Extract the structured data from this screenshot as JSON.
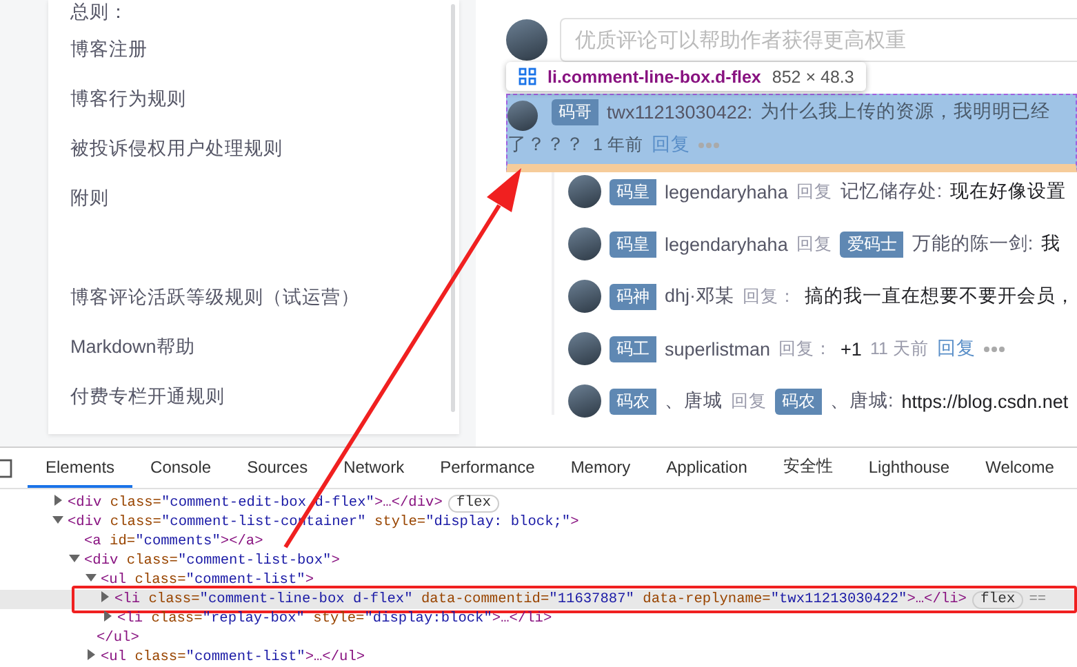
{
  "sidebar": {
    "groups": [
      {
        "items": [
          {
            "label": "总则：",
            "selected": false
          },
          {
            "label": "博客注册",
            "selected": false
          },
          {
            "label": "博客行为规则",
            "selected": false
          },
          {
            "label": "被投诉侵权用户处理规则",
            "selected": false
          },
          {
            "label": "附则",
            "selected": false
          }
        ]
      },
      {
        "items": [
          {
            "label": "博客评论活跃等级规则（试运营）",
            "selected": false
          },
          {
            "label": "Markdown帮助",
            "selected": false
          },
          {
            "label": "付费专栏开通规则",
            "selected": false
          }
        ]
      }
    ]
  },
  "comment_input": {
    "placeholder": "优质评论可以帮助作者获得更高权重"
  },
  "inspect_tooltip": {
    "selector": "li.comment-line-box.d-flex",
    "size": "852 × 48.3"
  },
  "comment": {
    "badge": "码哥",
    "name": "twx11213030422:",
    "text": "为什么我上传的资源，我明明已经",
    "text_cont": "了？？？",
    "time": "1 年前",
    "reply": "回复",
    "highlighted": true
  },
  "replies": [
    {
      "badge": "码皇",
      "name": "legendaryhaha",
      "action": "回复",
      "target": "记忆储存处:",
      "text": "现在好像设置"
    },
    {
      "badge": "码皇",
      "name": "legendaryhaha",
      "action": "回复",
      "target_badge": "爱码士",
      "target": "万能的陈一剑:",
      "text": "我"
    },
    {
      "badge": "码神",
      "name": "dhj·邓某",
      "action": "回复：",
      "text": "搞的我一直在想要不要开会员，"
    },
    {
      "badge": "码工",
      "name": "superlistman",
      "action": "回复：",
      "text": "+1",
      "time": "11 天前",
      "reply": "回复"
    },
    {
      "badge": "码农",
      "name": "、唐城",
      "action": "回复",
      "target_badge": "码农",
      "target": "、唐城:",
      "text": "https://blog.csdn.net"
    }
  ],
  "devtools": {
    "tabs": [
      {
        "label": "Elements",
        "selected": true
      },
      {
        "label": "Console",
        "selected": false
      },
      {
        "label": "Sources",
        "selected": false
      },
      {
        "label": "Network",
        "selected": false
      },
      {
        "label": "Performance",
        "selected": false
      },
      {
        "label": "Memory",
        "selected": false
      },
      {
        "label": "Application",
        "selected": false
      },
      {
        "label": "安全性",
        "selected": false
      },
      {
        "label": "Lighthouse",
        "selected": false
      },
      {
        "label": "Welcome",
        "selected": false
      }
    ],
    "dom_tree": [
      {
        "text": "<div class=\"comment-edit-box d-flex\">…</div>",
        "expanded": false,
        "selected": false,
        "badge": "flex"
      },
      {
        "text": "<div class=\"comment-list-container\" style=\"display: block;\">",
        "expanded": true,
        "selected": false,
        "children": [
          {
            "text": "<a id=\"comments\"></a>",
            "selected": false
          },
          {
            "text": "<div class=\"comment-list-box\">",
            "expanded": true,
            "selected": false,
            "children": [
              {
                "text": "<ul class=\"comment-list\">",
                "expanded": true,
                "selected": false,
                "close": "</ul>",
                "children": [
                  {
                    "text": "<li class=\"comment-line-box d-flex\" data-commentid=\"11637887\" data-replyname=\"twx11213030422\">…</li>",
                    "expanded": false,
                    "selected": true,
                    "badge": "flex",
                    "suffix": "=="
                  },
                  {
                    "text": "<li class=\"replay-box\" style=\"display:block\">…</li>",
                    "expanded": false,
                    "selected": false
                  }
                ]
              },
              {
                "text": "<ul class=\"comment-list\">…</ul>",
                "expanded": false,
                "selected": false
              }
            ]
          }
        ]
      }
    ]
  }
}
